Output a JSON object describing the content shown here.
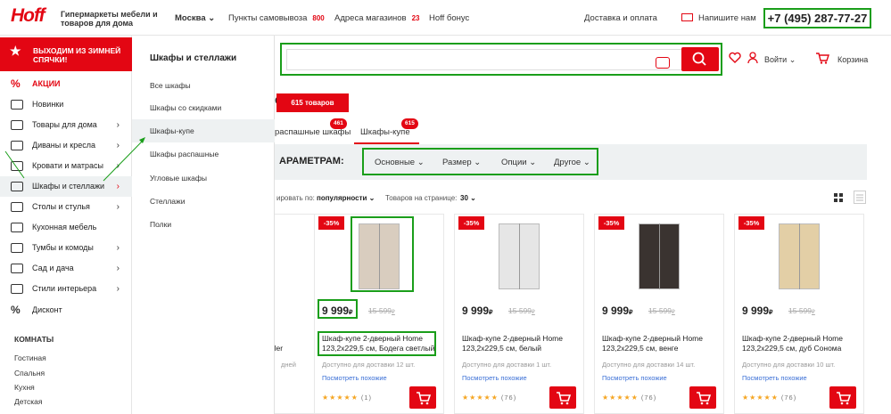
{
  "header": {
    "logo": "Hoff",
    "tagline": "Гипермаркеты мебели и товаров для дома",
    "city": "Москва",
    "pickup": "Пункты самовывоза",
    "pickup_count": "800",
    "stores": "Адреса магазинов",
    "stores_count": "23",
    "bonus": "Hoff бонус",
    "delivery": "Доставка и оплата",
    "write": "Напишите нам",
    "phone": "+7 (495) 287-77-27"
  },
  "sidebar": {
    "promo": "ВЫХОДИМ ИЗ ЗИМНЕЙ СПЯЧКИ!",
    "items": [
      {
        "label": "АКЦИИ"
      },
      {
        "label": "Новинки"
      },
      {
        "label": "Товары для дома"
      },
      {
        "label": "Диваны и кресла"
      },
      {
        "label": "Кровати и матрасы"
      },
      {
        "label": "Шкафы и стеллажи"
      },
      {
        "label": "Столы и стулья"
      },
      {
        "label": "Кухонная мебель"
      },
      {
        "label": "Тумбы и комоды"
      },
      {
        "label": "Сад и дача"
      },
      {
        "label": "Стили интерьера"
      },
      {
        "label": "Дисконт"
      }
    ],
    "rooms_title": "КОМНАТЫ",
    "rooms": [
      "Гостиная",
      "Спальня",
      "Кухня",
      "Детская"
    ]
  },
  "submenu": {
    "title": "Шкафы и стеллажи",
    "items": [
      "Все шкафы",
      "Шкафы со скидками",
      "Шкафы-купе",
      "Шкафы распашные",
      "Угловые шкафы",
      "Стеллажи",
      "Полки"
    ]
  },
  "user": {
    "login": "Войти",
    "cart": "Корзина"
  },
  "page": {
    "title_tail": "е",
    "count": "615 товаров",
    "tabs": [
      {
        "label": "распашные шкафы",
        "badge": "461"
      },
      {
        "label": "Шкафы-купе",
        "badge": "615"
      }
    ],
    "filter_label": "АРАМЕТРАМ:",
    "filters": [
      "Основные",
      "Размер",
      "Опции",
      "Другое"
    ],
    "sort_label": "ировать по:",
    "sort_value": "популярности",
    "per_page_label": "Товаров на странице:",
    "per_page": "30"
  },
  "products": [
    {
      "discount": "-35%",
      "price": "9 999",
      "currency": "₽",
      "old": "15 599",
      "name": "Шкаф-купе 2-дверный Home 123,2x229,5 см, Бодега светлый",
      "avail": "Доступно для доставки 12 шт.",
      "similar": "Посмотреть похожие",
      "reviews": "(1)",
      "color": "#d9cdbf"
    },
    {
      "discount": "-35%",
      "price": "9 999",
      "currency": "₽",
      "old": "15 599",
      "name": "Шкаф-купе 2-дверный Home 123,2x229,5 см, белый",
      "avail": "Доступно для доставки 1 шт.",
      "similar": "Посмотреть похожие",
      "reviews": "(76)",
      "color": "#e6e6e6"
    },
    {
      "discount": "-35%",
      "price": "9 999",
      "currency": "₽",
      "old": "15 599",
      "name": "Шкаф-купе 2-дверный Home 123,2x229,5 см, венге",
      "avail": "Доступно для доставки 14 шт.",
      "similar": "Посмотреть похожие",
      "reviews": "(76)",
      "color": "#3a3330"
    },
    {
      "discount": "-35%",
      "price": "9 999",
      "currency": "₽",
      "old": "15 599",
      "name": "Шкаф-купе 2-дверный Home 123,2x229,5 см, дуб Сонома",
      "avail": "Доступно для доставки 10 шт.",
      "similar": "Посмотреть похожие",
      "reviews": "(76)",
      "color": "#e3cfa6"
    }
  ],
  "partial": {
    "name_a": "е",
    "name_b": "eller",
    "avail": "дней"
  }
}
